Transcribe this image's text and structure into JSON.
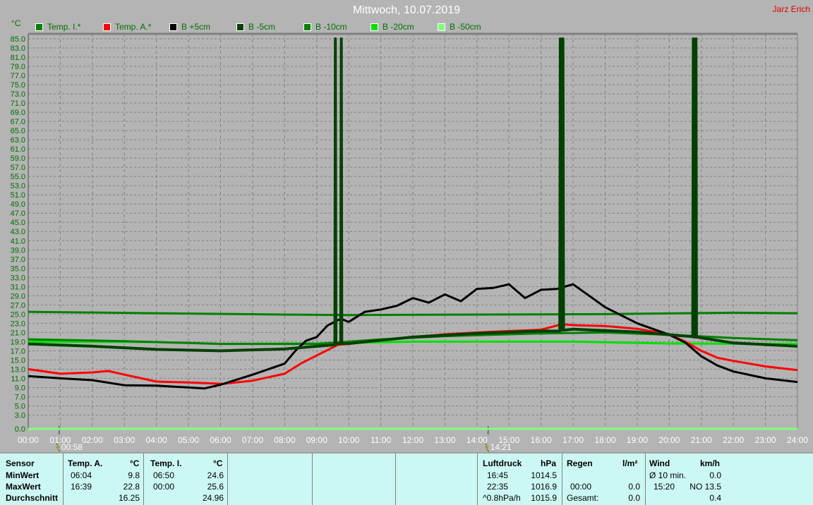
{
  "header": {
    "title": "Mittwoch, 10.07.2019",
    "author": "Jarz Erich",
    "unit": "°C"
  },
  "chart_data": {
    "type": "line",
    "title": "Mittwoch, 10.07.2019",
    "ylabel": "°C",
    "xlim": [
      "00:00",
      "24:00"
    ],
    "ylim": [
      0,
      85
    ],
    "grid": true,
    "legend_placement": "top",
    "x_ticks": [
      "00:00",
      "01:00",
      "02:00",
      "03:00",
      "04:00",
      "05:00",
      "06:00",
      "07:00",
      "08:00",
      "09:00",
      "10:00",
      "11:00",
      "12:00",
      "13:00",
      "14:00",
      "15:00",
      "16:00",
      "17:00",
      "18:00",
      "19:00",
      "20:00",
      "21:00",
      "22:00",
      "23:00",
      "24:00"
    ],
    "y_ticks": [
      "0.0",
      "3.0",
      "5.0",
      "7.0",
      "9.0",
      "11.0",
      "13.0",
      "15.0",
      "17.0",
      "19.0",
      "21.0",
      "23.0",
      "25.0",
      "27.0",
      "29.0",
      "31.0",
      "33.0",
      "35.0",
      "37.0",
      "39.0",
      "41.0",
      "43.0",
      "45.0",
      "47.0",
      "49.0",
      "51.0",
      "53.0",
      "55.0",
      "57.0",
      "59.0",
      "61.0",
      "63.0",
      "65.0",
      "67.0",
      "69.0",
      "71.0",
      "73.0",
      "75.0",
      "77.0",
      "79.0",
      "81.0",
      "83.0",
      "85.0"
    ],
    "markers": [
      {
        "time": "00:58",
        "label": "00:58"
      },
      {
        "time": "14:21",
        "label": "14:21"
      }
    ],
    "series": [
      {
        "name": "Temp. I.*",
        "color": "#008000",
        "points": [
          [
            "00:00",
            25.5
          ],
          [
            "04:00",
            25.2
          ],
          [
            "08:00",
            24.9
          ],
          [
            "10:00",
            24.8
          ],
          [
            "14:00",
            24.9
          ],
          [
            "18:00",
            25
          ],
          [
            "22:00",
            25.3
          ],
          [
            "24:00",
            25.2
          ]
        ]
      },
      {
        "name": "Temp. A.*",
        "color": "#ff0000",
        "points": [
          [
            "00:00",
            13
          ],
          [
            "01:00",
            12
          ],
          [
            "02:00",
            12.3
          ],
          [
            "02:30",
            12.6
          ],
          [
            "03:00",
            11.8
          ],
          [
            "04:00",
            10.3
          ],
          [
            "05:00",
            10.1
          ],
          [
            "06:04",
            9.8
          ],
          [
            "07:00",
            10.5
          ],
          [
            "08:00",
            12
          ],
          [
            "08:30",
            14.2
          ],
          [
            "09:00",
            16
          ],
          [
            "09:40",
            18.3
          ],
          [
            "10:00",
            18.5
          ],
          [
            "11:00",
            19.3
          ],
          [
            "12:00",
            20
          ],
          [
            "13:00",
            20.6
          ],
          [
            "14:00",
            21
          ],
          [
            "15:00",
            21.3
          ],
          [
            "16:00",
            21.6
          ],
          [
            "16:39",
            22.8
          ],
          [
            "17:00",
            22.6
          ],
          [
            "18:00",
            22.4
          ],
          [
            "19:00",
            21.8
          ],
          [
            "20:00",
            20.6
          ],
          [
            "20:30",
            19
          ],
          [
            "21:00",
            17
          ],
          [
            "21:30",
            15.5
          ],
          [
            "22:00",
            14.8
          ],
          [
            "23:00",
            13.6
          ],
          [
            "24:00",
            12.8
          ]
        ]
      },
      {
        "name": "B +5cm",
        "color": "#000000",
        "points": [
          [
            "00:00",
            11.5
          ],
          [
            "01:00",
            11
          ],
          [
            "02:00",
            10.6
          ],
          [
            "03:00",
            9.5
          ],
          [
            "04:00",
            9.4
          ],
          [
            "05:00",
            9
          ],
          [
            "05:30",
            8.8
          ],
          [
            "06:00",
            9.6
          ],
          [
            "07:00",
            11.8
          ],
          [
            "08:00",
            14.2
          ],
          [
            "08:20",
            17
          ],
          [
            "08:40",
            19.2
          ],
          [
            "09:00",
            20
          ],
          [
            "09:20",
            22.5
          ],
          [
            "09:45",
            24
          ],
          [
            "10:00",
            23.3
          ],
          [
            "10:30",
            25.5
          ],
          [
            "11:00",
            26
          ],
          [
            "11:30",
            26.8
          ],
          [
            "12:00",
            28.5
          ],
          [
            "12:30",
            27.5
          ],
          [
            "13:00",
            29.3
          ],
          [
            "13:30",
            27.8
          ],
          [
            "14:00",
            30.5
          ],
          [
            "14:30",
            30.7
          ],
          [
            "15:00",
            31.5
          ],
          [
            "15:30",
            28.5
          ],
          [
            "16:00",
            30.3
          ],
          [
            "16:30",
            30.5
          ],
          [
            "17:00",
            31.5
          ],
          [
            "17:30",
            29
          ],
          [
            "18:00",
            26.5
          ],
          [
            "19:00",
            23
          ],
          [
            "20:00",
            20.5
          ],
          [
            "20:30",
            18.8
          ],
          [
            "21:00",
            15.8
          ],
          [
            "21:30",
            13.8
          ],
          [
            "22:00",
            12.5
          ],
          [
            "23:00",
            11
          ],
          [
            "24:00",
            10.2
          ]
        ]
      },
      {
        "name": "B -5cm",
        "color": "#004000",
        "points": [
          [
            "00:00",
            18.5
          ],
          [
            "02:00",
            18
          ],
          [
            "04:00",
            17.3
          ],
          [
            "06:00",
            17
          ],
          [
            "08:00",
            17.4
          ],
          [
            "09:34",
            18.3
          ],
          [
            "09:35",
            85
          ],
          [
            "09:36",
            18.5
          ],
          [
            "09:45",
            18.6
          ],
          [
            "09:46",
            85
          ],
          [
            "09:47",
            18.6
          ],
          [
            "10:00",
            18.6
          ],
          [
            "12:00",
            20
          ],
          [
            "14:00",
            20.8
          ],
          [
            "16:00",
            21.3
          ],
          [
            "16:35",
            21.3
          ],
          [
            "16:36",
            85
          ],
          [
            "16:37",
            21.5
          ],
          [
            "16:40",
            21.5
          ],
          [
            "16:41",
            85
          ],
          [
            "16:42",
            21.5
          ],
          [
            "17:00",
            21.7
          ],
          [
            "19:00",
            21.1
          ],
          [
            "20:00",
            20.5
          ],
          [
            "20:44",
            20.1
          ],
          [
            "20:45",
            85
          ],
          [
            "20:46",
            20
          ],
          [
            "20:49",
            20
          ],
          [
            "20:50",
            85
          ],
          [
            "20:51",
            20
          ],
          [
            "22:00",
            18.7
          ],
          [
            "24:00",
            18
          ]
        ]
      },
      {
        "name": "B -10cm",
        "color": "#008000",
        "points": [
          [
            "00:00",
            19.5
          ],
          [
            "03:00",
            19.1
          ],
          [
            "06:00",
            18.5
          ],
          [
            "09:00",
            18.5
          ],
          [
            "11:00",
            19.5
          ],
          [
            "13:00",
            20.2
          ],
          [
            "16:00",
            20.8
          ],
          [
            "18:00",
            21
          ],
          [
            "20:00",
            20.5
          ],
          [
            "22:00",
            19.8
          ],
          [
            "24:00",
            19.3
          ]
        ]
      },
      {
        "name": "B -20cm",
        "color": "#00e000",
        "points": [
          [
            "00:00",
            19
          ],
          [
            "04:00",
            18.9
          ],
          [
            "06:00",
            18.5
          ],
          [
            "09:00",
            18.6
          ],
          [
            "12:00",
            19
          ],
          [
            "17:00",
            19
          ],
          [
            "20:00",
            18.6
          ],
          [
            "24:00",
            18.5
          ]
        ]
      },
      {
        "name": "B -50cm",
        "color": "#80ff80",
        "points": [
          [
            "00:00",
            0
          ],
          [
            "24:00",
            0
          ]
        ]
      }
    ]
  },
  "stats": {
    "sensor": "Sensor",
    "min": "MinWert",
    "max": "MaxWert",
    "avg": "Durchschnitt",
    "temp_a": {
      "label": "Temp. A.",
      "unit": "°C",
      "min_time": "06:04",
      "min": "9.8",
      "max_time": "16:39",
      "max": "22.8",
      "avg": "16.25"
    },
    "temp_i": {
      "label": "Temp. I.",
      "unit": "°C",
      "min_time": "06:50",
      "min": "24.6",
      "max_time": "00:00",
      "max": "25.6",
      "avg": "24.96"
    },
    "pressure": {
      "label": "Luftdruck",
      "unit": "hPa",
      "min_time": "16:45",
      "min": "1014.5",
      "max_time": "22:35",
      "max": "1016.9",
      "trend": "^0.8hPa/h",
      "current": "1015.9"
    },
    "rain": {
      "label": "Regen",
      "unit": "l/m²",
      "max_time": "00:00",
      "max": "0.0",
      "total_label": "Gesamt:",
      "total": "0.0"
    },
    "wind": {
      "label": "Wind",
      "unit": "km/h",
      "avg_label": "Ø 10 min.",
      "avg": "0.0",
      "max_time": "15:20",
      "max": "NO 13.5",
      "current": "0.4"
    }
  }
}
